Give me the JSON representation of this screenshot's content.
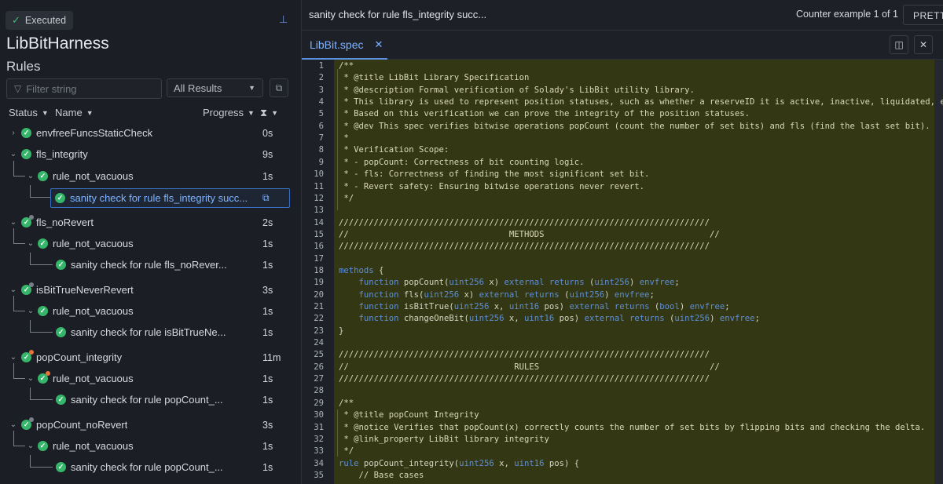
{
  "left_panel": {
    "status_badge": "Executed",
    "title": "LibBitHarness",
    "subtitle": "Rules",
    "filter_placeholder": "Filter string",
    "results_select": "All Results",
    "columns": {
      "status": "Status",
      "name": "Name",
      "progress": "Progress"
    },
    "rules": [
      {
        "label": "envfreeFuncsStaticCheck",
        "time": "0s"
      },
      {
        "label": "fls_integrity",
        "time": "9s"
      },
      {
        "label": "rule_not_vacuous",
        "time": "1s"
      },
      {
        "label": "sanity check for rule fls_integrity succ...",
        "time": ""
      },
      {
        "label": "fls_noRevert",
        "time": "2s"
      },
      {
        "label": "rule_not_vacuous",
        "time": "1s"
      },
      {
        "label": "sanity check for rule fls_noRever...",
        "time": "1s"
      },
      {
        "label": "isBitTrueNeverRevert",
        "time": "3s"
      },
      {
        "label": "rule_not_vacuous",
        "time": "1s"
      },
      {
        "label": "sanity check for rule isBitTrueNe...",
        "time": "1s"
      },
      {
        "label": "popCount_integrity",
        "time": "11m"
      },
      {
        "label": "rule_not_vacuous",
        "time": "1s"
      },
      {
        "label": "sanity check for rule popCount_...",
        "time": "1s"
      },
      {
        "label": "popCount_noRevert",
        "time": "3s"
      },
      {
        "label": "rule_not_vacuous",
        "time": "1s"
      },
      {
        "label": "sanity check for rule popCount_...",
        "time": "1s"
      }
    ]
  },
  "right_panel": {
    "rule_title": "sanity check for rule fls_integrity succ...",
    "counter_example": "Counter example 1 of 1",
    "pretty_button": "PRETT",
    "tab_name": "LibBit.spec",
    "code_lines": [
      "/**",
      " * @title LibBit Library Specification",
      " * @description Formal verification of Solady's LibBit utility library.",
      " * This library is used to represent position statuses, such as whether a reserveID it is active, inactive, liquidated, etc.",
      " * Based on this verification we can prove the integrity of the position statuses.",
      " * @dev This spec verifies bitwise operations popCount (count the number of set bits) and fls (find the last set bit).",
      " *",
      " * Verification Scope:",
      " * - popCount: Correctness of bit counting logic.",
      " * - fls: Correctness of finding the most significant set bit.",
      " * - Revert safety: Ensuring bitwise operations never revert.",
      " */",
      "",
      "//////////////////////////////////////////////////////////////////////////",
      "//                                METHODS                                 //",
      "//////////////////////////////////////////////////////////////////////////",
      "",
      "methods {",
      "    function popCount(uint256 x) external returns (uint256) envfree;",
      "    function fls(uint256 x) external returns (uint256) envfree;",
      "    function isBitTrue(uint256 x, uint16 pos) external returns (bool) envfree;",
      "    function changeOneBit(uint256 x, uint16 pos) external returns (uint256) envfree;",
      "}",
      "",
      "//////////////////////////////////////////////////////////////////////////",
      "//                                 RULES                                  //",
      "//////////////////////////////////////////////////////////////////////////",
      "",
      "/**",
      " * @title popCount Integrity",
      " * @notice Verifies that popCount(x) correctly counts the number of set bits by flipping bits and checking the delta.",
      " * @link_property LibBit library integrity",
      " */",
      "rule popCount_integrity(uint256 x, uint16 pos) {",
      "    // Base cases"
    ]
  }
}
